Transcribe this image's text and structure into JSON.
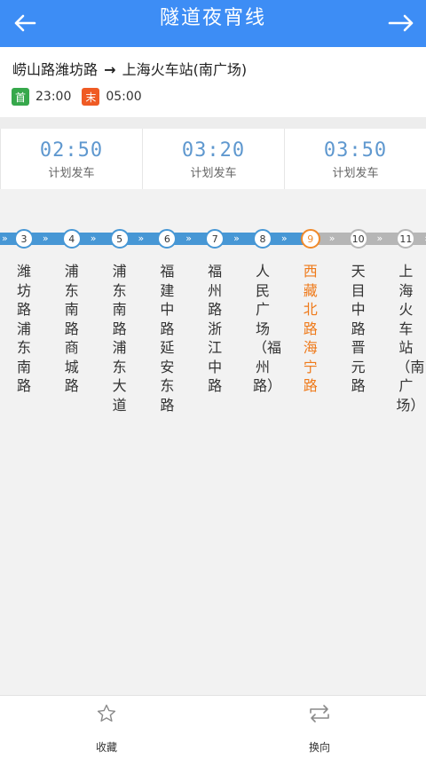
{
  "header": {
    "title": "隧道夜宵线",
    "back_icon": "arrow-left-icon",
    "switch_icon": "arrow-right-icon"
  },
  "route": {
    "from": "崂山路潍坊路",
    "arrow": "→",
    "to": "上海火车站(南广场)",
    "first_badge": "首",
    "first_time": "23:00",
    "last_badge": "末",
    "last_time": "05:00"
  },
  "schedule": [
    {
      "time": "02:50",
      "label": "计划发车"
    },
    {
      "time": "03:20",
      "label": "计划发车"
    },
    {
      "time": "03:50",
      "label": "计划发车"
    }
  ],
  "stations": [
    {
      "num": "3",
      "name": "潍坊路浦东南路",
      "state": "passed"
    },
    {
      "num": "4",
      "name": "浦东南路商城路",
      "state": "passed"
    },
    {
      "num": "5",
      "name": "浦东南路浦东大道",
      "state": "passed"
    },
    {
      "num": "6",
      "name": "福建中路延安东路",
      "state": "passed"
    },
    {
      "num": "7",
      "name": "福州路浙江中路",
      "state": "passed"
    },
    {
      "num": "8",
      "name": "人民广场（福州路）",
      "state": "passed"
    },
    {
      "num": "9",
      "name": "西藏北路海宁路",
      "state": "current"
    },
    {
      "num": "10",
      "name": "天目中路晋元路",
      "state": "upcoming"
    },
    {
      "num": "11",
      "name": "上海火车站（南广场）",
      "state": "upcoming"
    }
  ],
  "colors": {
    "primary": "#3d8df5",
    "passed_line": "#4797d5",
    "upcoming_line": "#b6b6b6",
    "current": "#f08a2b",
    "first_badge": "#36a84b",
    "last_badge": "#ef5b24"
  },
  "footer": {
    "favorite_label": "收藏",
    "favorite_icon": "star-outline-icon",
    "switch_label": "换向",
    "switch_icon": "swap-direction-icon"
  }
}
